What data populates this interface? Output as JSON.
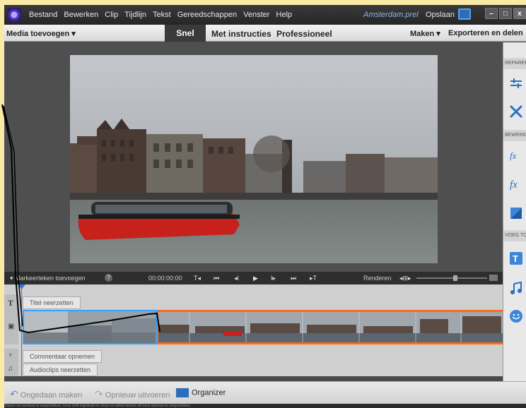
{
  "menubar": {
    "items": [
      "Bestand",
      "Bewerken",
      "Clip",
      "Tijdlijn",
      "Tekst",
      "Gereedschappen",
      "Venster",
      "Help"
    ],
    "project_name": "Amsterdam.prel",
    "save_label": "Opslaan",
    "minimize_label": "–",
    "maximize_label": "□",
    "close_label": "x"
  },
  "modebar": {
    "add_media": "Media toevoegen ▾",
    "tabs": [
      "Snel",
      "Met instructies",
      "Professioneel"
    ],
    "active_tab": "Snel",
    "create": "Maken ▾",
    "export": "Exporteren en delen"
  },
  "right_panel": {
    "sections": [
      "REPAREREN",
      "BEWERKEN",
      "VOEG TOE"
    ],
    "icons": [
      "adjust-icon",
      "tools-icon",
      "fx-edit-icon",
      "fx-icon",
      "color-icon",
      "title-icon",
      "music-icon",
      "smiley-icon"
    ]
  },
  "transport": {
    "add_marker": "▾  Markeerteken toevoegen",
    "help": "?",
    "timecode": "00:00:00:00",
    "render": "Renderen"
  },
  "timeline": {
    "title_track_button": "Titel neerzetten",
    "narration_button": "Commentaar opnemen",
    "audio_button": "Audioclips neerzetten"
  },
  "bottombar": {
    "undo": "Ongedaan maken",
    "redo": "Opnieuw uitvoeren",
    "organizer": "Organizer"
  },
  "statusbar": {
    "hint": "Slepen om opnieuw te rangschikken, houd Shift ingedrukt en sleep om alleen binnen dit track opnieuw te rangschikken."
  },
  "colors": {
    "selected_clip_border": "#31a2ff",
    "clip_border": "#ff6a1a",
    "playhead": "#2b7fd8",
    "background_frame": "#fbe9a6"
  }
}
